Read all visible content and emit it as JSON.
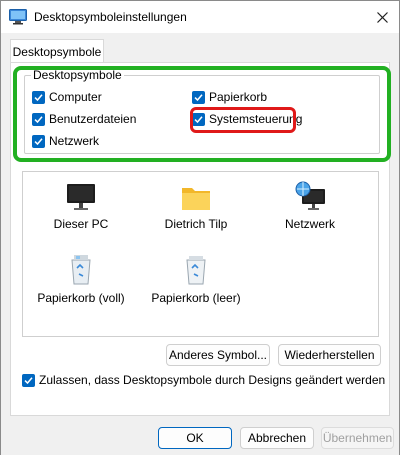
{
  "window": {
    "title": "Desktopsymboleinstellungen",
    "close_icon": "close-icon",
    "app_icon": "desktop-settings-icon"
  },
  "tab": {
    "label": "Desktopsymbole"
  },
  "group": {
    "legend": "Desktopsymbole",
    "checkboxes": {
      "computer": {
        "label": "Computer",
        "checked": true
      },
      "papierkorb": {
        "label": "Papierkorb",
        "checked": true
      },
      "benutzerdateien": {
        "label": "Benutzerdateien",
        "checked": true
      },
      "systemsteuerung": {
        "label": "Systemsteuerung",
        "checked": true
      },
      "netzwerk": {
        "label": "Netzwerk",
        "checked": true
      }
    }
  },
  "icons": {
    "dieser_pc": "Dieser PC",
    "dietrich_tilp": "Dietrich Tilp",
    "netzwerk": "Netzwerk",
    "papierkorb_voll": "Papierkorb (voll)",
    "papierkorb_leer": "Papierkorb (leer)"
  },
  "buttons": {
    "anderes_symbol": "Anderes Symbol...",
    "wiederherstellen": "Wiederherstellen",
    "ok": "OK",
    "abbrechen": "Abbrechen",
    "uebernehmen": "Übernehmen"
  },
  "allow_themes": {
    "label": "Zulassen, dass Desktopsymbole durch Designs geändert werden",
    "checked": true
  },
  "colors": {
    "accent": "#0067c0",
    "highlight_green": "#22b022",
    "highlight_red": "#e01919"
  }
}
